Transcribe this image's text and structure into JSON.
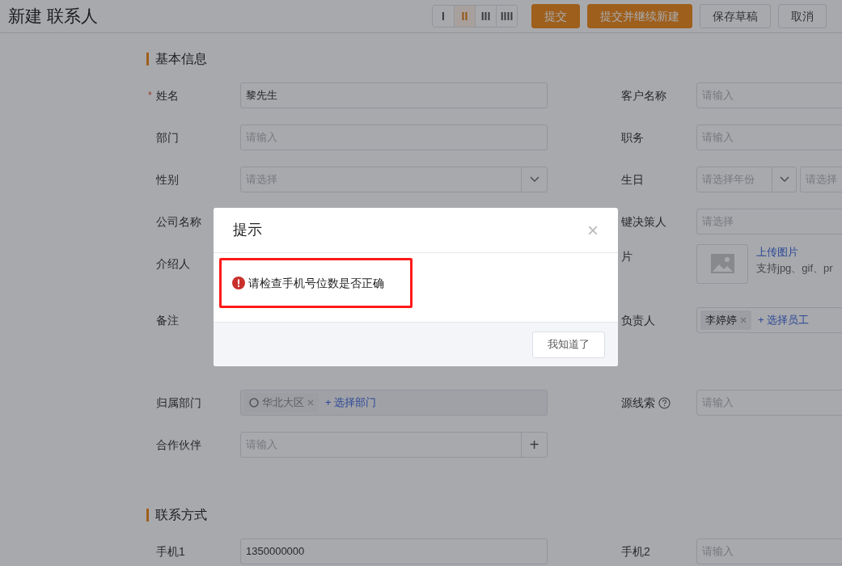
{
  "page_title": "新建 联系人",
  "layout_options": [
    {
      "label": "I",
      "selected": false
    },
    {
      "label": "II",
      "selected": true
    },
    {
      "label": "III",
      "selected": false
    },
    {
      "label": "IIII",
      "selected": false
    }
  ],
  "actions": [
    {
      "label": "提交",
      "kind": "primary"
    },
    {
      "label": "提交并继续新建",
      "kind": "primary"
    },
    {
      "label": "保存草稿",
      "kind": "default"
    },
    {
      "label": "取消",
      "kind": "default"
    }
  ],
  "sections": [
    {
      "title": "基本信息",
      "rows": [
        {
          "left": {
            "label": "姓名",
            "mark": "*",
            "kind": "input",
            "value": "黎先生"
          },
          "right": {
            "label": "客户名称",
            "kind": "input",
            "placeholder": "请输入"
          }
        },
        {
          "left": {
            "label": "部门",
            "kind": "input",
            "placeholder": "请输入"
          },
          "right": {
            "label": "职务",
            "kind": "input",
            "placeholder": "请输入"
          }
        },
        {
          "left": {
            "label": "性别",
            "kind": "select",
            "placeholder": "请选择"
          },
          "right": {
            "label": "生日",
            "kind": "date",
            "placeholders": [
              "请选择年份",
              "请选择"
            ]
          }
        },
        {
          "left": {
            "label": "公司名称",
            "kind": "covered"
          },
          "right": {
            "label": "键决策人",
            "kind": "picker",
            "placeholder": "请选择"
          }
        },
        {
          "left": {
            "label": "介绍人",
            "kind": "covered"
          },
          "right": {
            "label": "片",
            "kind": "image",
            "link": "上传图片",
            "hint": "支持jpg、gif、pr"
          }
        },
        {
          "left": {
            "label": "备注",
            "kind": "covered-textarea"
          },
          "right": {
            "label": "负责人",
            "kind": "tags",
            "tags": [
              "李婷婷"
            ],
            "add": "+ 选择员工"
          }
        },
        {
          "left": {
            "label": "归属部门",
            "kind": "tags",
            "disabled": true,
            "tags": [
              "华北大区"
            ],
            "add": "+ 选择部门"
          },
          "right": {
            "label": "源线索",
            "help": true,
            "kind": "input",
            "placeholder": "请输入"
          }
        },
        {
          "left": {
            "label": "合作伙伴",
            "kind": "input-add",
            "placeholder": "请输入",
            "button": "+"
          }
        }
      ]
    },
    {
      "title": "联系方式",
      "rows": [
        {
          "left": {
            "label": "手机1",
            "kind": "input",
            "value": "1350000000"
          },
          "right": {
            "label": "手机2",
            "kind": "input",
            "placeholder": "请输入"
          }
        }
      ]
    }
  ],
  "dialog": {
    "title": "提示",
    "close": "×",
    "message": "请检查手机号位数是否正确",
    "highlighted": true,
    "button": "我知道了"
  }
}
